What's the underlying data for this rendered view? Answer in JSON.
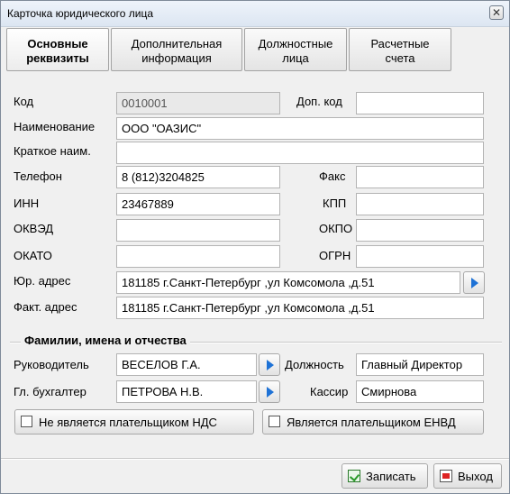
{
  "window": {
    "title": "Карточка юридического лица",
    "close_glyph": "✕"
  },
  "tabs": [
    {
      "line1": "Основные",
      "line2": "реквизиты"
    },
    {
      "line1": "Дополнительная",
      "line2": "информация"
    },
    {
      "line1": "Должностные",
      "line2": "лица"
    },
    {
      "line1": "Расчетные",
      "line2": "счета"
    }
  ],
  "form": {
    "code": {
      "label": "Код",
      "value": "0010001"
    },
    "extra_code": {
      "label": "Доп. код",
      "value": ""
    },
    "name": {
      "label": "Наименование",
      "value": "ООО \"ОАЗИС\""
    },
    "short_name": {
      "label": "Краткое наим.",
      "value": ""
    },
    "phone": {
      "label": "Телефон",
      "value": "8 (812)3204825"
    },
    "fax": {
      "label": "Факс",
      "value": ""
    },
    "inn": {
      "label": "ИНН",
      "value": "23467889"
    },
    "kpp": {
      "label": "КПП",
      "value": ""
    },
    "okved": {
      "label": "ОКВЭД",
      "value": ""
    },
    "okpo": {
      "label": "ОКПО",
      "value": ""
    },
    "okato": {
      "label": "ОКАТО",
      "value": ""
    },
    "ogrn": {
      "label": "ОГРН",
      "value": ""
    },
    "legal_address": {
      "label": "Юр. адрес",
      "value": "181185 г.Санкт-Петербург ,ул Комсомола ,д.51"
    },
    "actual_address": {
      "label": "Факт. адрес",
      "value": "181185 г.Санкт-Петербург ,ул Комсомола ,д.51"
    }
  },
  "persons": {
    "group_title": "Фамилии,  имена и отчества",
    "director": {
      "label": "Руководитель",
      "value": "ВЕСЕЛОВ Г.А."
    },
    "position": {
      "label": "Должность",
      "value": "Главный Директор"
    },
    "accountant": {
      "label": "Гл. бухгалтер",
      "value": "ПЕТРОВА Н.В."
    },
    "cashier": {
      "label": "Кассир",
      "value": "Смирнова"
    }
  },
  "checkboxes": {
    "not_vat_payer": {
      "label": "Не является плательщиком НДС",
      "checked": false
    },
    "envd_payer": {
      "label": "Является плательщиком ЕНВД",
      "checked": false
    }
  },
  "buttons": {
    "save": "Записать",
    "exit": "Выход"
  },
  "icons": {
    "arrow": "right-arrow-icon",
    "save": "save-icon",
    "exit": "exit-icon"
  },
  "colors": {
    "accent": "#1e72d6"
  }
}
